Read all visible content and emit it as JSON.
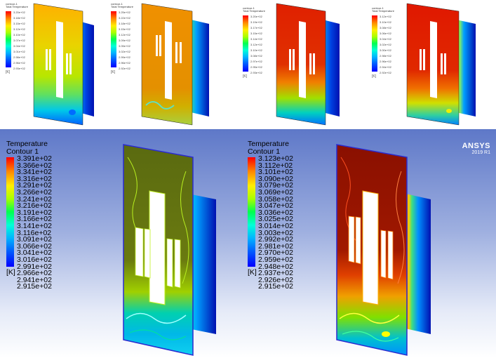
{
  "legends": [
    {
      "title": "contour-1",
      "subtitle": "Total Temperature",
      "ticks": [
        "3.20e+02",
        "3.18e+02",
        "3.15e+02",
        "3.12e+02",
        "3.10e+02",
        "3.07e+02",
        "3.04e+02",
        "3.01e+02",
        "2.98e+02",
        "2.96e+02",
        "2.93e+02"
      ],
      "unit": "[K]"
    },
    {
      "title": "contour-1",
      "subtitle": "Total Temperature",
      "ticks": [
        "3.25e+02",
        "3.22e+02",
        "3.18e+02",
        "3.15e+02",
        "3.12e+02",
        "3.09e+02",
        "3.05e+02",
        "3.02e+02",
        "2.99e+02",
        "2.96e+02",
        "2.92e+02"
      ],
      "unit": "[K]"
    },
    {
      "title": "contour-1",
      "subtitle": "Total Temperature",
      "ticks": [
        "3.20e+02",
        "3.19e+02",
        "3.17e+02",
        "3.15e+02",
        "3.14e+02",
        "3.12e+02",
        "3.10e+02",
        "3.08e+02",
        "2.97e+02",
        "2.95e+02",
        "2.93e+02"
      ],
      "unit": "[K]"
    },
    {
      "title": "contour-1",
      "subtitle": "Total Temperature",
      "ticks": [
        "3.12e+02",
        "3.10e+02",
        "3.08e+02",
        "3.06e+02",
        "3.04e+02",
        "3.02e+02",
        "3.00e+02",
        "2.98e+02",
        "2.96e+02",
        "2.94e+02",
        "2.92e+02"
      ],
      "unit": "[K]"
    },
    {
      "title": "Temperature",
      "subtitle": "Contour 1",
      "ticks": [
        "3.391e+02",
        "3.366e+02",
        "3.341e+02",
        "3.316e+02",
        "3.291e+02",
        "3.266e+02",
        "3.241e+02",
        "3.216e+02",
        "3.191e+02",
        "3.166e+02",
        "3.141e+02",
        "3.116e+02",
        "3.091e+02",
        "3.066e+02",
        "3.041e+02",
        "3.016e+02",
        "2.991e+02",
        "2.966e+02",
        "2.941e+02",
        "2.915e+02"
      ],
      "unit": "[K]"
    },
    {
      "title": "Temperature",
      "subtitle": "Contour 1",
      "ticks": [
        "3.123e+02",
        "3.112e+02",
        "3.101e+02",
        "3.090e+02",
        "3.079e+02",
        "3.069e+02",
        "3.058e+02",
        "3.047e+02",
        "3.036e+02",
        "3.025e+02",
        "3.014e+02",
        "3.003e+02",
        "2.992e+02",
        "2.981e+02",
        "2.970e+02",
        "2.959e+02",
        "2.948e+02",
        "2.937e+02",
        "2.926e+02",
        "2.915e+02"
      ],
      "unit": "[K]"
    }
  ],
  "brand": {
    "name": "ANSYS",
    "version": "2019 R1"
  },
  "colors": {
    "background_top": "#5e78c8",
    "background_bottom": "#ffffff",
    "hot": "#ff2a00",
    "cool": "#0018d8"
  }
}
